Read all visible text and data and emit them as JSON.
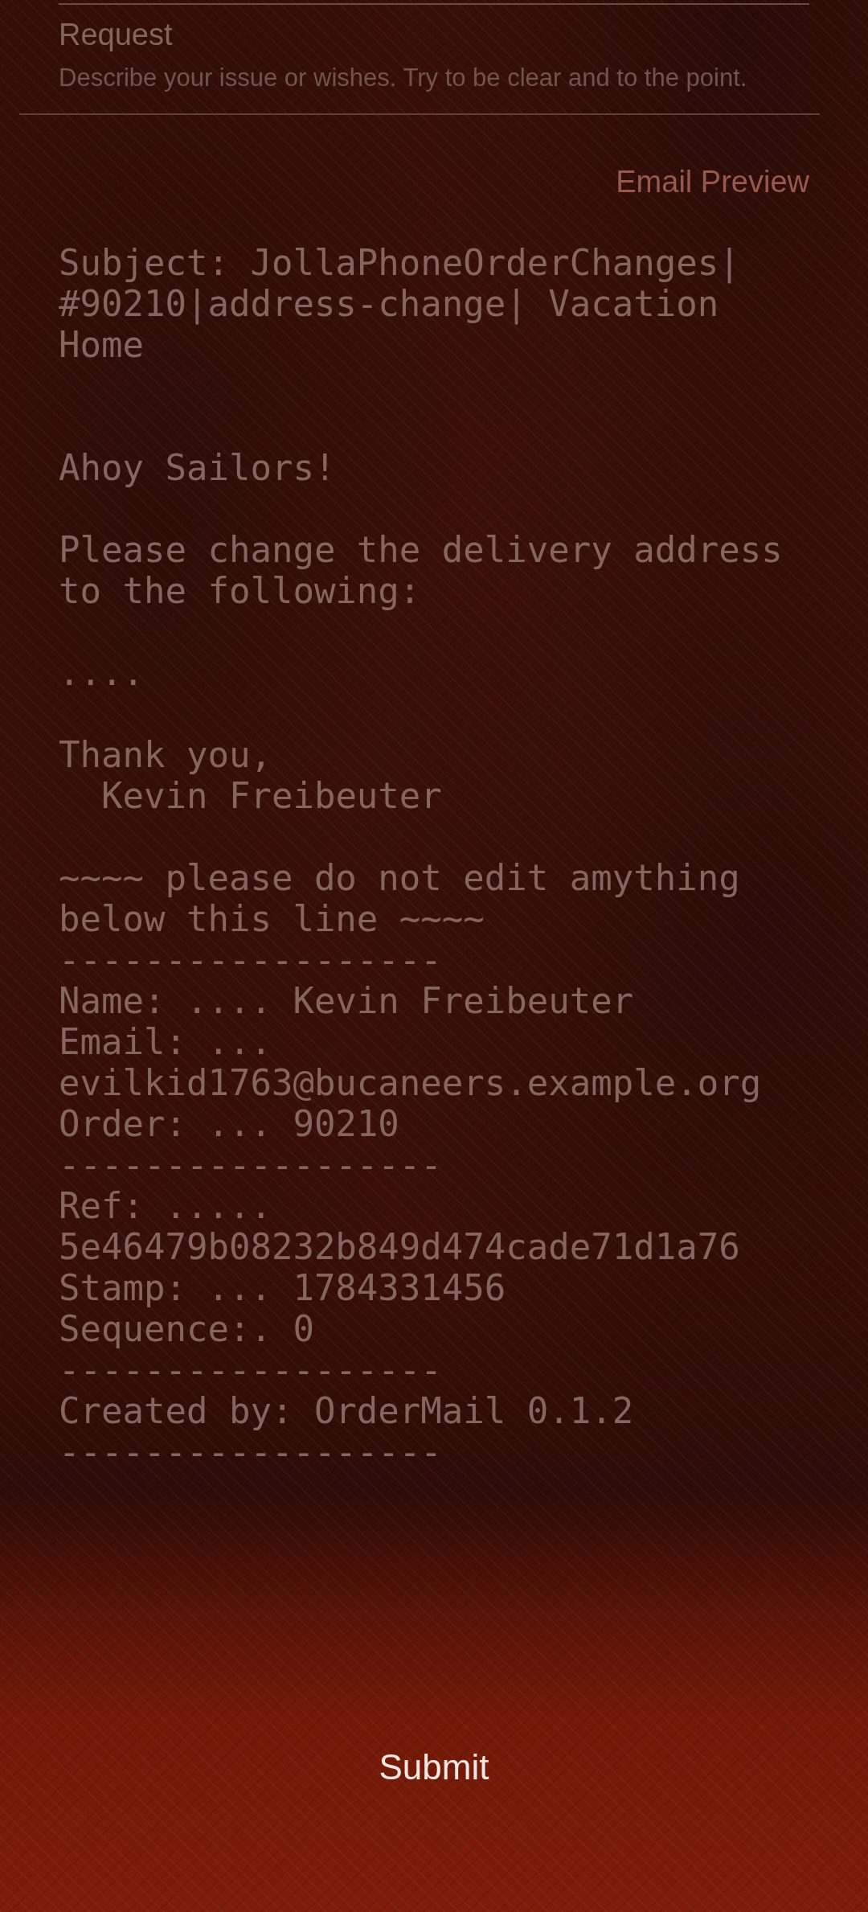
{
  "request_field": {
    "label": "Request",
    "description": "Describe your issue or wishes. Try to be clear and to the point."
  },
  "email_preview": {
    "heading": "Email Preview",
    "subject": "Subject: JollaPhoneOrderChanges| #90210|address-change| Vacation Home",
    "body_blocks": [
      [
        "Ahoy Sailors!"
      ],
      [
        "Please change the delivery address to the following:"
      ],
      [
        "...."
      ],
      [
        "Thank you,",
        "  Kevin Freibeuter"
      ],
      [
        "~~~~ please do not edit amything below this line ~~~~",
        "------------------",
        "Name: .... Kevin Freibeuter",
        "Email: ... evilkid1763@bucaneers.example.org",
        "Order: ... 90210",
        "------------------",
        "Ref: ..... 5e46479b08232b849d474cade71d1a76",
        "Stamp: ... 1784331456",
        "Sequence:. 0",
        "------------------",
        "Created by: OrderMail 0.1.2",
        "------------------"
      ]
    ]
  },
  "submit_button": {
    "label": "Submit"
  }
}
